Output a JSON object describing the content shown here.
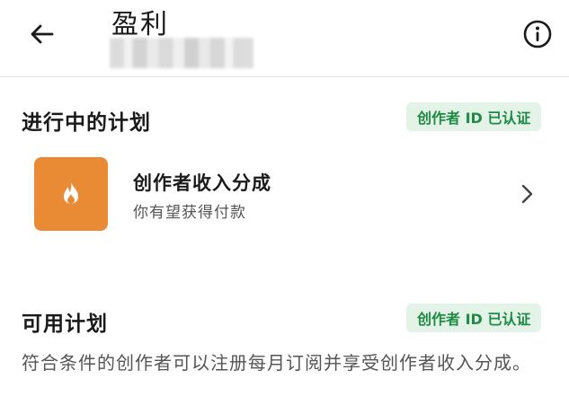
{
  "header": {
    "title": "盈利",
    "back_icon": "arrow-left-icon",
    "info_icon": "info-circle-icon"
  },
  "in_progress": {
    "title": "进行中的计划",
    "badge": "创作者 ID 已认证",
    "program": {
      "name": "创作者收入分成",
      "description": "你有望获得付款",
      "icon": "flame-icon"
    }
  },
  "available": {
    "title": "可用计划",
    "badge": "创作者 ID 已认证",
    "description": "符合条件的创作者可以注册每月订阅并享受创作者收入分成。"
  },
  "colors": {
    "accent_orange": "#e98a34",
    "badge_bg": "#e3f3e7",
    "badge_text": "#1f8a45"
  }
}
